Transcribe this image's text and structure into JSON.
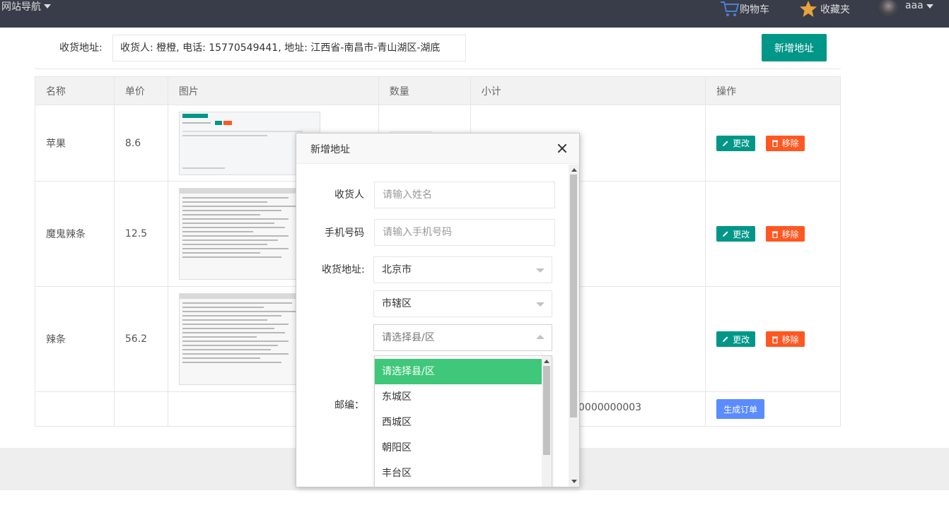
{
  "topbar": {
    "nav_label": "网站导航",
    "cart_label": "购物车",
    "favorites_label": "收藏夹",
    "username": "aaa"
  },
  "address": {
    "label": "收货地址:",
    "value": "收货人: 橙橙, 电话: 15770549441, 地址: 江西省-南昌市-青山湖区-湖底",
    "add_button": "新增地址"
  },
  "table": {
    "headers": [
      "名称",
      "单价",
      "图片",
      "数量",
      "小计",
      "操作"
    ],
    "rows": [
      {
        "name": "苹果",
        "price": "8.6"
      },
      {
        "name": "魔鬼辣条",
        "price": "12.5"
      },
      {
        "name": "辣条",
        "price": "56.2"
      }
    ],
    "edit_label": "更改",
    "remove_label": "移除",
    "order_number": "0000000003",
    "generate_order_label": "生成订单"
  },
  "modal": {
    "title": "新增地址",
    "consignee_label": "收货人",
    "consignee_placeholder": "请输入姓名",
    "phone_label": "手机号码",
    "phone_placeholder": "请输入手机号码",
    "address_label": "收货地址:",
    "province_value": "北京市",
    "city_value": "市辖区",
    "district_placeholder": "请选择县/区",
    "zip_label": "邮编：",
    "district_options": [
      "请选择县/区",
      "东城区",
      "西城区",
      "朝阳区",
      "丰台区"
    ]
  },
  "colors": {
    "topbar": "#393d49",
    "teal": "#009688",
    "orange": "#ff5722",
    "blue": "#5a8bff",
    "selected_option": "#3fc77a"
  }
}
